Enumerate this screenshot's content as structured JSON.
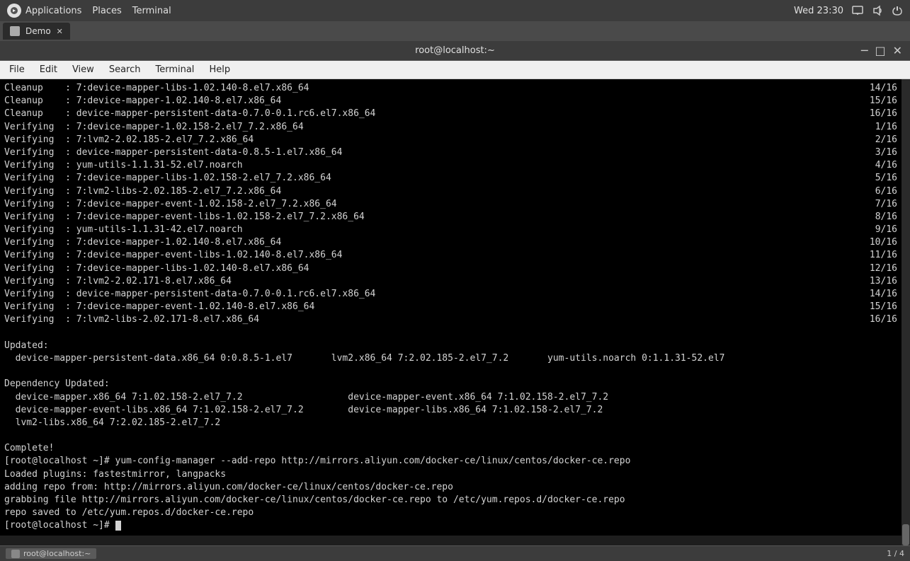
{
  "system_bar": {
    "app_label": "Applications",
    "places_label": "Places",
    "terminal_label": "Terminal",
    "clock": "Wed 23:30",
    "icons": [
      "display-icon",
      "volume-icon",
      "power-icon"
    ]
  },
  "tab_bar": {
    "tab": {
      "label": "Demo",
      "active": true
    }
  },
  "terminal_window": {
    "title": "root@localhost:~",
    "menu_items": [
      "File",
      "Edit",
      "View",
      "Search",
      "Terminal",
      "Help"
    ],
    "lines": [
      {
        "left": "Cleanup    : 7:device-mapper-libs-1.02.140-8.el7.x86_64",
        "right": "14/16"
      },
      {
        "left": "Cleanup    : 7:device-mapper-1.02.140-8.el7.x86_64",
        "right": "15/16"
      },
      {
        "left": "Cleanup    : device-mapper-persistent-data-0.7.0-0.1.rc6.el7.x86_64",
        "right": "16/16"
      },
      {
        "left": "Verifying  : 7:device-mapper-1.02.158-2.el7_7.2.x86_64",
        "right": "1/16"
      },
      {
        "left": "Verifying  : 7:lvm2-2.02.185-2.el7_7.2.x86_64",
        "right": "2/16"
      },
      {
        "left": "Verifying  : device-mapper-persistent-data-0.8.5-1.el7.x86_64",
        "right": "3/16"
      },
      {
        "left": "Verifying  : yum-utils-1.1.31-52.el7.noarch",
        "right": "4/16"
      },
      {
        "left": "Verifying  : 7:device-mapper-libs-1.02.158-2.el7_7.2.x86_64",
        "right": "5/16"
      },
      {
        "left": "Verifying  : 7:lvm2-libs-2.02.185-2.el7_7.2.x86_64",
        "right": "6/16"
      },
      {
        "left": "Verifying  : 7:device-mapper-event-1.02.158-2.el7_7.2.x86_64",
        "right": "7/16"
      },
      {
        "left": "Verifying  : 7:device-mapper-event-libs-1.02.158-2.el7_7.2.x86_64",
        "right": "8/16"
      },
      {
        "left": "Verifying  : yum-utils-1.1.31-42.el7.noarch",
        "right": "9/16"
      },
      {
        "left": "Verifying  : 7:device-mapper-1.02.140-8.el7.x86_64",
        "right": "10/16"
      },
      {
        "left": "Verifying  : 7:device-mapper-event-libs-1.02.140-8.el7.x86_64",
        "right": "11/16"
      },
      {
        "left": "Verifying  : 7:device-mapper-libs-1.02.140-8.el7.x86_64",
        "right": "12/16"
      },
      {
        "left": "Verifying  : 7:lvm2-2.02.171-8.el7.x86_64",
        "right": "13/16"
      },
      {
        "left": "Verifying  : device-mapper-persistent-data-0.7.0-0.1.rc6.el7.x86_64",
        "right": "14/16"
      },
      {
        "left": "Verifying  : 7:device-mapper-event-1.02.140-8.el7.x86_64",
        "right": "15/16"
      },
      {
        "left": "Verifying  : 7:lvm2-libs-2.02.171-8.el7.x86_64",
        "right": "16/16"
      }
    ],
    "updated_section": {
      "header": "Updated:",
      "line1": "  device-mapper-persistent-data.x86_64 0:0.8.5-1.el7       lvm2.x86_64 7:2.02.185-2.el7_7.2       yum-utils.noarch 0:1.1.31-52.el7"
    },
    "dependency_section": {
      "header": "Dependency Updated:",
      "lines": [
        "  device-mapper.x86_64 7:1.02.158-2.el7_7.2                   device-mapper-event.x86_64 7:1.02.158-2.el7_7.2",
        "  device-mapper-event-libs.x86_64 7:1.02.158-2.el7_7.2        device-mapper-libs.x86_64 7:1.02.158-2.el7_7.2",
        "  lvm2-libs.x86_64 7:2.02.185-2.el7_7.2"
      ]
    },
    "command_block": {
      "complete": "Complete!",
      "prompt1": "[root@localhost ~]# yum-config-manager --add-repo http://mirrors.aliyun.com/docker-ce/linux/centos/docker-ce.repo",
      "loaded": "Loaded plugins: fastestmirror, langpacks",
      "adding": "adding repo from: http://mirrors.aliyun.com/docker-ce/linux/centos/docker-ce.repo",
      "grabbing": "grabbing file http://mirrors.aliyun.com/docker-ce/linux/centos/docker-ce.repo to /etc/yum.repos.d/docker-ce.repo",
      "repo_saved": "repo saved to /etc/yum.repos.d/docker-ce.repo",
      "prompt2": "[root@localhost ~]# "
    }
  },
  "status_bar": {
    "tab_label": "root@localhost:~",
    "page_indicator": "1 / 4"
  }
}
